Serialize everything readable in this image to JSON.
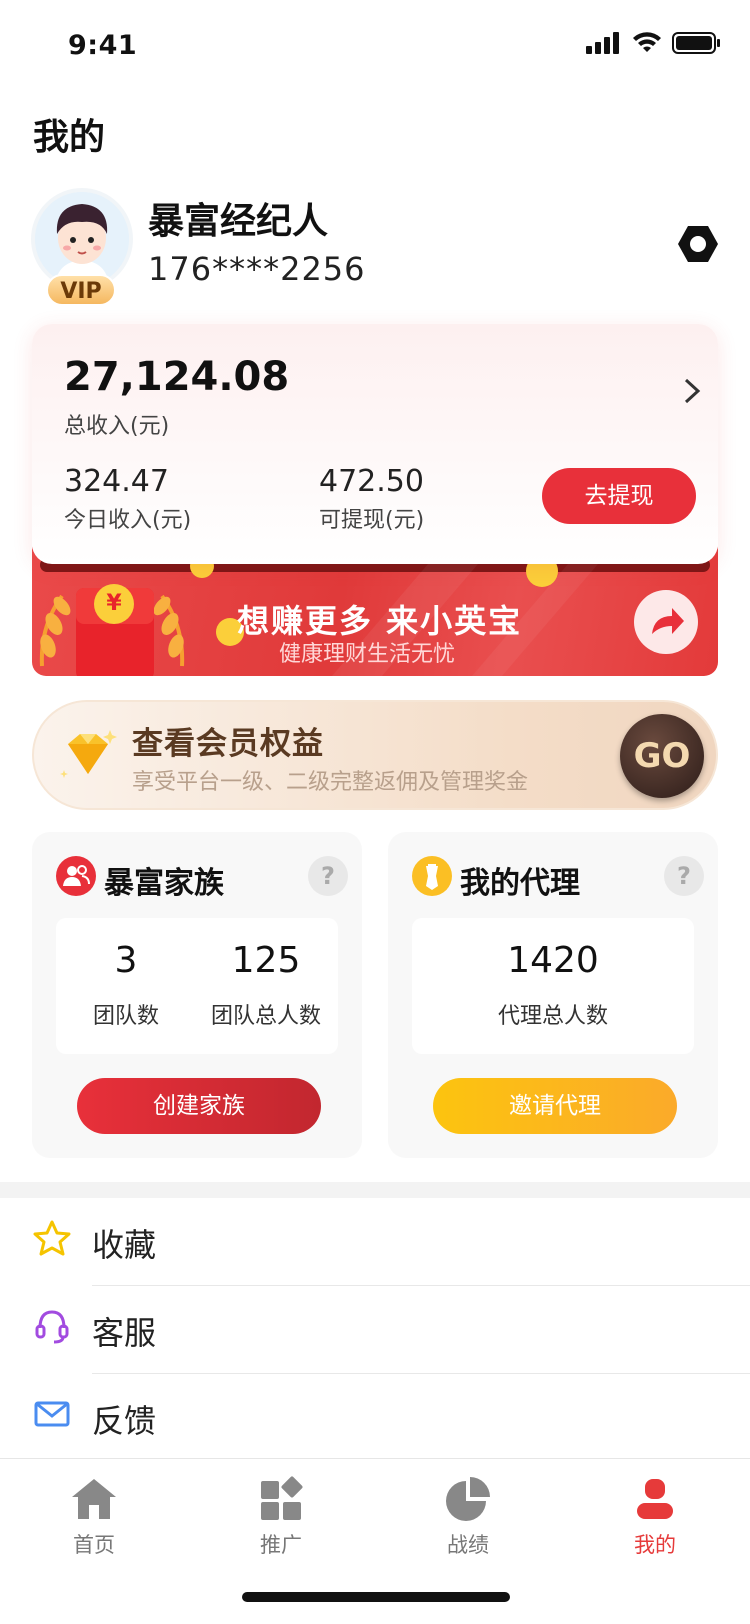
{
  "status_bar": {
    "time": "9:41"
  },
  "header": {
    "title": "我的"
  },
  "profile": {
    "vip_label": "VIP",
    "name": "暴富经纪人",
    "phone": "176****2256"
  },
  "income_card": {
    "total": "27,124.08",
    "total_label": "总收入(元)",
    "today": "324.47",
    "today_label": "今日收入(元)",
    "available": "472.50",
    "available_label": "可提现(元)",
    "withdraw_label": "去提现"
  },
  "banner": {
    "title": "想赚更多  来小英宝",
    "subtitle": "健康理财生活无忧",
    "red_packet_symbol": "¥"
  },
  "vip_strip": {
    "title": "查看会员权益",
    "subtitle": "享受平台一级、二级完整返佣及管理奖金",
    "go_label": "GO"
  },
  "family_panel": {
    "title": "暴富家族",
    "help": "?",
    "teams_value": "3",
    "teams_label": "团队数",
    "members_value": "125",
    "members_label": "团队总人数",
    "button_label": "创建家族"
  },
  "agent_panel": {
    "title": "我的代理",
    "help": "?",
    "agents_value": "1420",
    "agents_label": "代理总人数",
    "button_label": "邀请代理"
  },
  "menu": [
    {
      "label": "收藏",
      "icon": "star-icon"
    },
    {
      "label": "客服",
      "icon": "headset-icon"
    },
    {
      "label": "反馈",
      "icon": "mail-icon"
    }
  ],
  "tabs": [
    {
      "label": "首页",
      "icon": "home-icon"
    },
    {
      "label": "推广",
      "icon": "promote-icon"
    },
    {
      "label": "战绩",
      "icon": "pie-chart-icon"
    },
    {
      "label": "我的",
      "icon": "user-icon",
      "active": true
    }
  ],
  "colors": {
    "accent_red": "#e8303a",
    "accent_yellow": "#fbbf24",
    "active_tab": "#e63a3a"
  }
}
